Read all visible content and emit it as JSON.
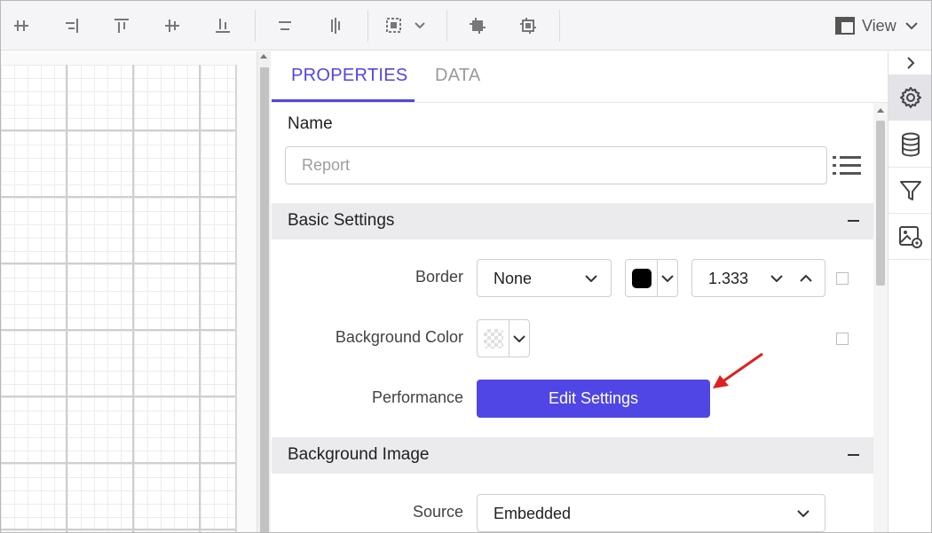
{
  "toolbar": {
    "icons": [
      "align-middle-icon",
      "align-right-icon",
      "align-top-icon",
      "align-center-icon",
      "align-bottom-icon",
      "distribute-horizontal-icon",
      "distribute-vertical-icon",
      "select-region-icon",
      "bring-forward-icon",
      "send-backward-icon"
    ],
    "view_label": "View"
  },
  "tabs": {
    "properties": "PROPERTIES",
    "data": "DATA",
    "active": "PROPERTIES"
  },
  "name_field": {
    "label": "Name",
    "placeholder": "Report",
    "value": ""
  },
  "basic_settings": {
    "title": "Basic Settings",
    "border": {
      "label": "Border",
      "style_value": "None",
      "color": "#000000",
      "width_value": "1.333"
    },
    "background_color": {
      "label": "Background Color"
    },
    "performance": {
      "label": "Performance",
      "button_label": "Edit Settings"
    }
  },
  "background_image": {
    "title": "Background Image",
    "source": {
      "label": "Source",
      "value": "Embedded"
    }
  },
  "rightbar": {
    "items": [
      "gear-icon",
      "database-icon",
      "filter-icon",
      "image-settings-icon"
    ],
    "active": "gear-icon"
  },
  "colors": {
    "accent": "#4f46e5",
    "annotation_arrow": "#e01f1f"
  }
}
